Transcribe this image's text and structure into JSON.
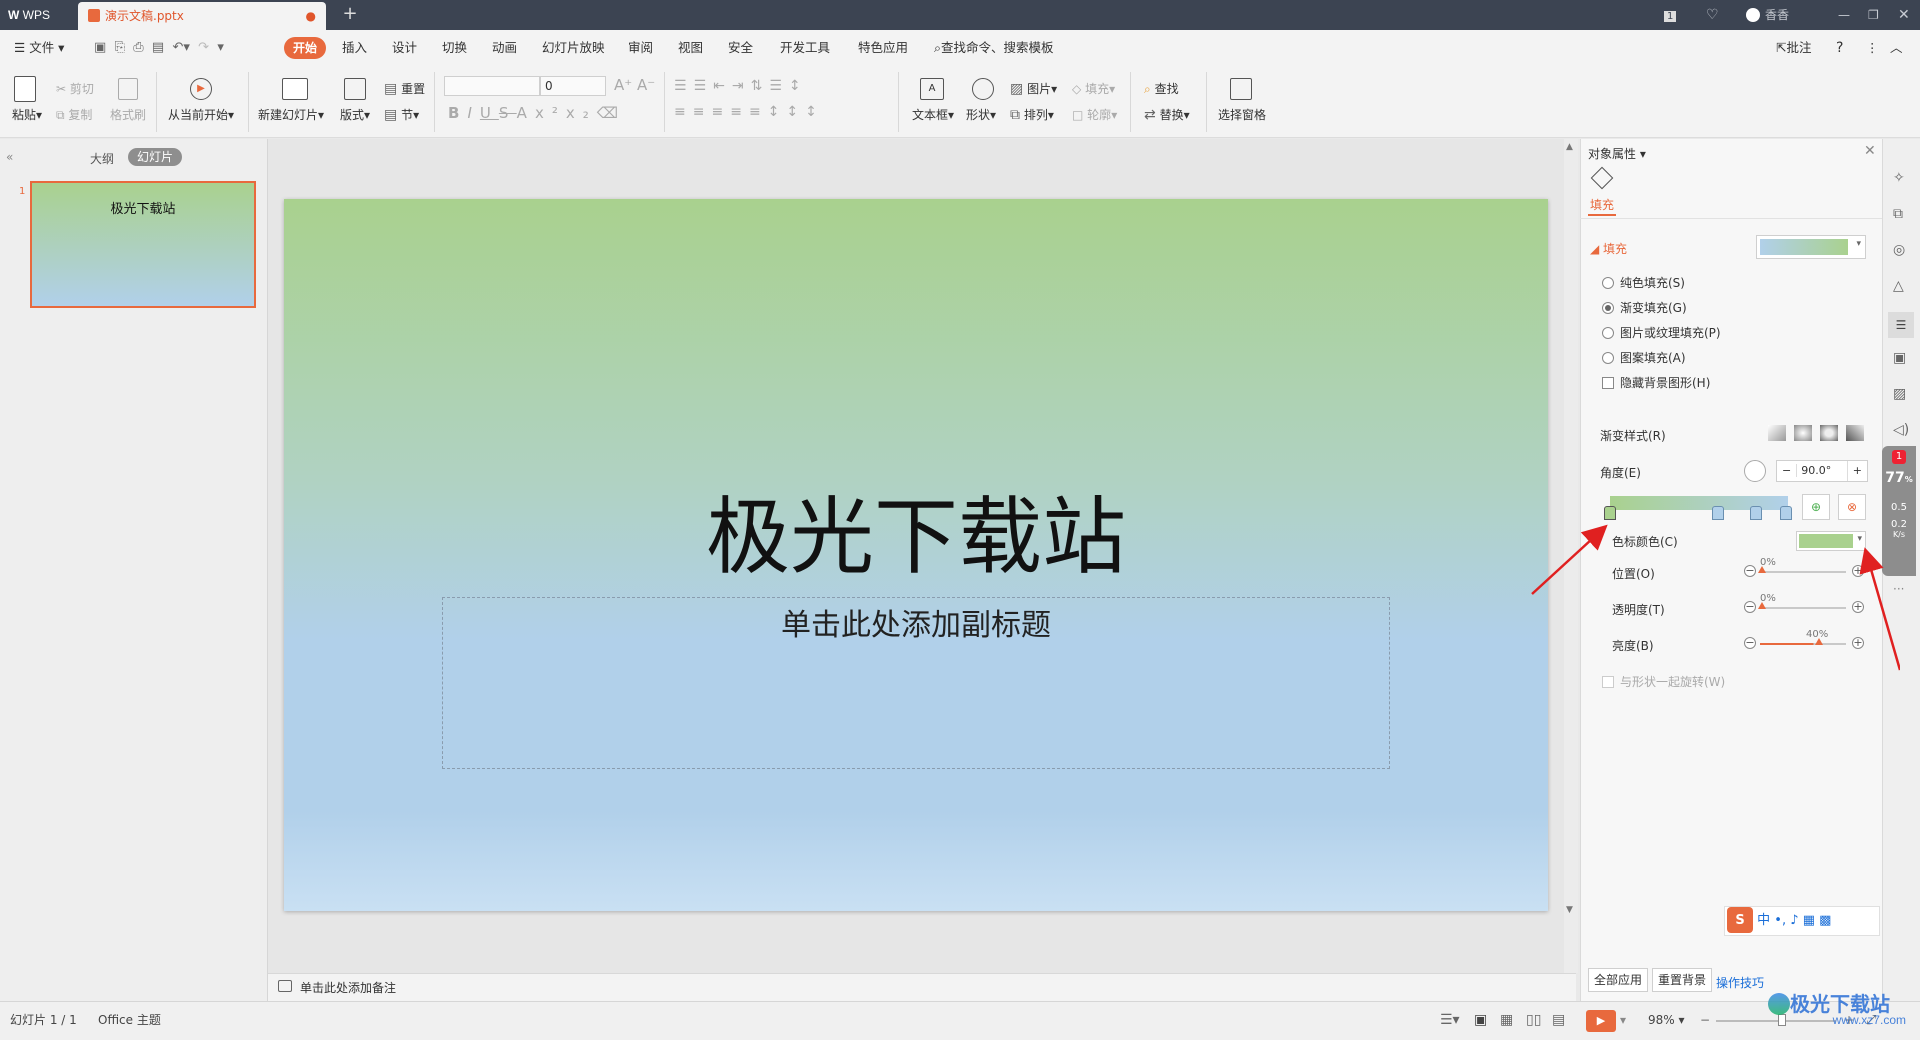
{
  "title_bar": {
    "app_tab": "WPS",
    "doc_tab": "演示文稿.pptx",
    "new_tab": "+",
    "badge": "1",
    "user": "香香"
  },
  "menu": {
    "file": "文件",
    "items": [
      "开始",
      "插入",
      "设计",
      "切换",
      "动画",
      "幻灯片放映",
      "审阅",
      "视图",
      "安全",
      "开发工具",
      "特色应用"
    ],
    "search": "查找命令、搜索模板",
    "comment": "批注"
  },
  "ribbon": {
    "paste": "粘贴",
    "cut": "剪切",
    "copy": "复制",
    "format_painter": "格式刷",
    "play_from_current": "从当前开始",
    "new_slide": "新建幻灯片",
    "layout": "版式",
    "reset": "重置",
    "section": "节",
    "font_size": "0",
    "textbox": "文本框",
    "shape": "形状",
    "picture": "图片",
    "fill": "填充",
    "arrange": "排列",
    "outline": "轮廓",
    "find": "查找",
    "replace": "替换",
    "selection_pane": "选择窗格"
  },
  "left_panel": {
    "tab_outline": "大纲",
    "tab_slides": "幻灯片",
    "slide_number": "1",
    "thumb_text": "极光下载站"
  },
  "slide": {
    "title": "极光下载站",
    "subtitle": "单击此处添加副标题",
    "gradient_top": "#a9d18e",
    "gradient_bottom": "#b1d0ea"
  },
  "notes_placeholder": "单击此处添加备注",
  "right_panel": {
    "header": "对象属性",
    "tab_fill": "填充",
    "section_fill": "填充",
    "options": {
      "solid": "纯色填充(S)",
      "gradient": "渐变填充(G)",
      "picture": "图片或纹理填充(P)",
      "pattern": "图案填充(A)",
      "hide_bg": "隐藏背景图形(H)"
    },
    "gradient_style": "渐变样式(R)",
    "angle_label": "角度(E)",
    "angle_value": "90.0°",
    "stop_color_label": "色标颜色(C)",
    "stop_color": "#a9d18e",
    "position_label": "位置(O)",
    "position_value": "0%",
    "transparency_label": "透明度(T)",
    "transparency_value": "0%",
    "brightness_label": "亮度(B)",
    "brightness_value": "40%",
    "rotate_with_shape": "与形状一起旋转(W)",
    "apply_all": "全部应用",
    "reset_bg": "重置背景",
    "tips": "操作技巧"
  },
  "ime_bar": {
    "lang": "中"
  },
  "side_widget": {
    "badge": "1",
    "percent": "77",
    "up": "0.5",
    "down": "0.2",
    "unit": "K/s"
  },
  "status_bar": {
    "slide_info": "幻灯片 1 / 1",
    "theme": "Office 主题",
    "zoom": "98%"
  },
  "watermark": {
    "name": "极光下载站",
    "url": "www.xz7.com"
  }
}
